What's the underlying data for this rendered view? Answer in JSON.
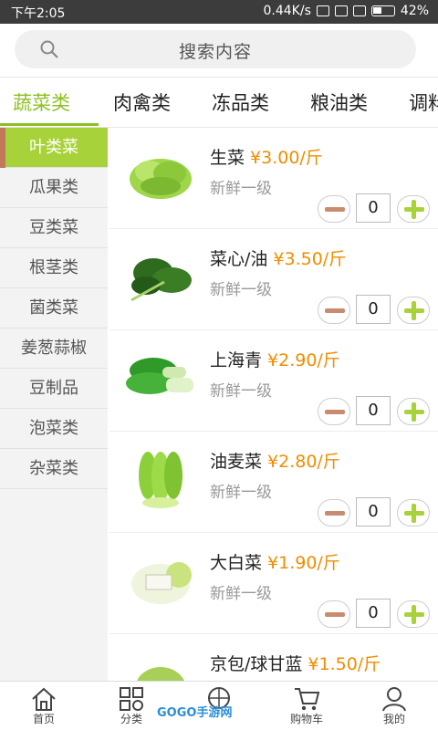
{
  "status_bar": {
    "time": "下午2:05",
    "network": "0.44K/s",
    "battery": "42%"
  },
  "search": {
    "placeholder": "搜索内容"
  },
  "tabs": [
    {
      "label": "蔬菜类",
      "active": true
    },
    {
      "label": "肉禽类"
    },
    {
      "label": "冻品类"
    },
    {
      "label": "粮油类"
    },
    {
      "label": "调料"
    }
  ],
  "sidebar": [
    {
      "label": "叶类菜",
      "active": true
    },
    {
      "label": "瓜果类"
    },
    {
      "label": "豆类菜"
    },
    {
      "label": "根茎类"
    },
    {
      "label": "菌类菜"
    },
    {
      "label": "姜葱蒜椒"
    },
    {
      "label": "豆制品"
    },
    {
      "label": "泡菜类"
    },
    {
      "label": "杂菜类"
    }
  ],
  "products": [
    {
      "name": "生菜",
      "price": "¥3.00/斤",
      "desc": "新鲜一级",
      "qty": "0"
    },
    {
      "name": "菜心/油",
      "price": "¥3.50/斤",
      "desc": "新鲜一级",
      "qty": "0"
    },
    {
      "name": "上海青",
      "price": "¥2.90/斤",
      "desc": "新鲜一级",
      "qty": "0"
    },
    {
      "name": "油麦菜",
      "price": "¥2.80/斤",
      "desc": "新鲜一级",
      "qty": "0"
    },
    {
      "name": "大白菜",
      "price": "¥1.90/斤",
      "desc": "新鲜一级",
      "qty": "0"
    },
    {
      "name": "京包/球甘蓝",
      "price": "¥1.50/斤",
      "desc": "",
      "qty": ""
    }
  ],
  "bottom_nav": [
    {
      "label": "首页",
      "icon": "home-icon"
    },
    {
      "label": "分类",
      "icon": "category-icon"
    },
    {
      "label": "",
      "icon": "center-icon"
    },
    {
      "label": "购物车",
      "icon": "cart-icon"
    },
    {
      "label": "我的",
      "icon": "profile-icon"
    }
  ],
  "watermark": "GOGO手游网",
  "colors": {
    "accent_green": "#8cc020",
    "price_orange": "#f08c00",
    "minus_brown": "#c98b6e"
  }
}
